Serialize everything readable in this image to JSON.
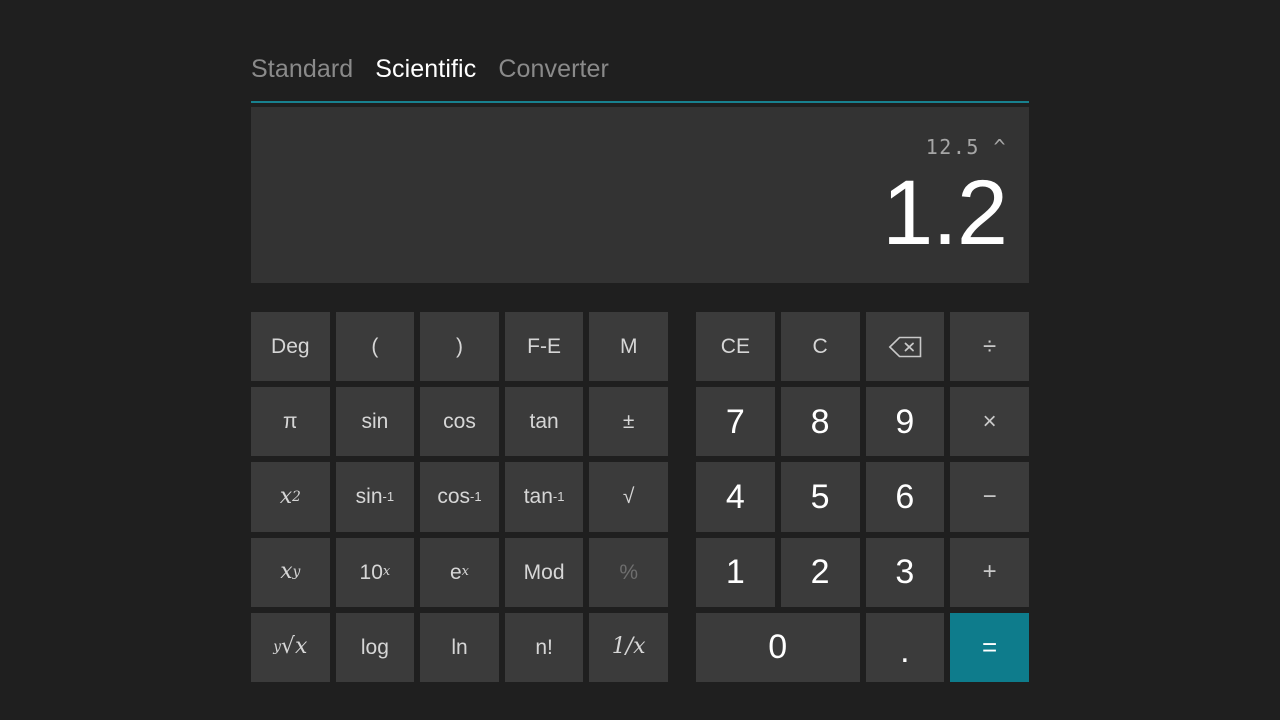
{
  "app": {
    "accent_color": "#0e7c8c",
    "underline_color": "#18818f",
    "background_color": "#1f1f1f",
    "display_background": "#333333",
    "button_background": "#3b3b3b"
  },
  "tabs": [
    {
      "label": "Standard",
      "active": false
    },
    {
      "label": "Scientific",
      "active": true
    },
    {
      "label": "Converter",
      "active": false
    }
  ],
  "display": {
    "expression": "12.5 ^",
    "result": "1.2"
  },
  "scientific_pad": {
    "rows": [
      [
        {
          "label": "Deg",
          "name": "deg-button"
        },
        {
          "label": "(",
          "name": "open-paren-button"
        },
        {
          "label": ")",
          "name": "close-paren-button"
        },
        {
          "label": "F-E",
          "name": "fe-button"
        },
        {
          "label": "M",
          "name": "memory-button"
        }
      ],
      [
        {
          "label": "π",
          "name": "pi-button"
        },
        {
          "label": "sin",
          "name": "sin-button"
        },
        {
          "label": "cos",
          "name": "cos-button"
        },
        {
          "label": "tan",
          "name": "tan-button"
        },
        {
          "label": "±",
          "name": "plus-minus-button"
        }
      ],
      [
        {
          "label": "x²",
          "name": "x-squared-button"
        },
        {
          "label": "sin⁻¹",
          "name": "arcsin-button"
        },
        {
          "label": "cos⁻¹",
          "name": "arccos-button"
        },
        {
          "label": "tan⁻¹",
          "name": "arctan-button"
        },
        {
          "label": "√",
          "name": "square-root-button"
        }
      ],
      [
        {
          "label": "xʸ",
          "name": "x-power-y-button"
        },
        {
          "label": "10ˣ",
          "name": "ten-power-x-button"
        },
        {
          "label": "eˣ",
          "name": "e-power-x-button"
        },
        {
          "label": "Mod",
          "name": "mod-button"
        },
        {
          "label": "%",
          "name": "percent-button"
        }
      ],
      [
        {
          "label": "ʸ√x",
          "name": "y-root-x-button"
        },
        {
          "label": "log",
          "name": "log-button"
        },
        {
          "label": "ln",
          "name": "ln-button"
        },
        {
          "label": "n!",
          "name": "factorial-button"
        },
        {
          "label": "1/x",
          "name": "reciprocal-button"
        }
      ]
    ],
    "labels": {
      "deg": "Deg",
      "open_paren": "(",
      "close_paren": ")",
      "fe": "F-E",
      "memory": "M",
      "pi": "π",
      "sin": "sin",
      "cos": "cos",
      "tan": "tan",
      "plus_minus": "±",
      "x_base": "x",
      "x_sup2": "2",
      "sin_inv_base": "sin",
      "sin_inv_sup": "-1",
      "cos_inv_base": "cos",
      "cos_inv_sup": "-1",
      "tan_inv_base": "tan",
      "tan_inv_sup": "-1",
      "sqrt": "√",
      "xy_base": "x",
      "xy_sup": "y",
      "ten_base": "10",
      "ten_sup": "x",
      "e_base": "e",
      "e_sup": "x",
      "mod": "Mod",
      "percent": "%",
      "yroot_pre": "y",
      "yroot_sym": "√",
      "yroot_x": "x",
      "log": "log",
      "ln": "ln",
      "factorial": "n!",
      "reciprocal": "1/x"
    }
  },
  "number_pad": {
    "clear_entry": "CE",
    "clear": "C",
    "backspace": "backspace",
    "divide": "÷",
    "multiply": "×",
    "subtract": "−",
    "add": "+",
    "equals": "=",
    "decimal": ".",
    "digits": {
      "seven": "7",
      "eight": "8",
      "nine": "9",
      "four": "4",
      "five": "5",
      "six": "6",
      "one": "1",
      "two": "2",
      "three": "3",
      "zero": "0"
    }
  }
}
